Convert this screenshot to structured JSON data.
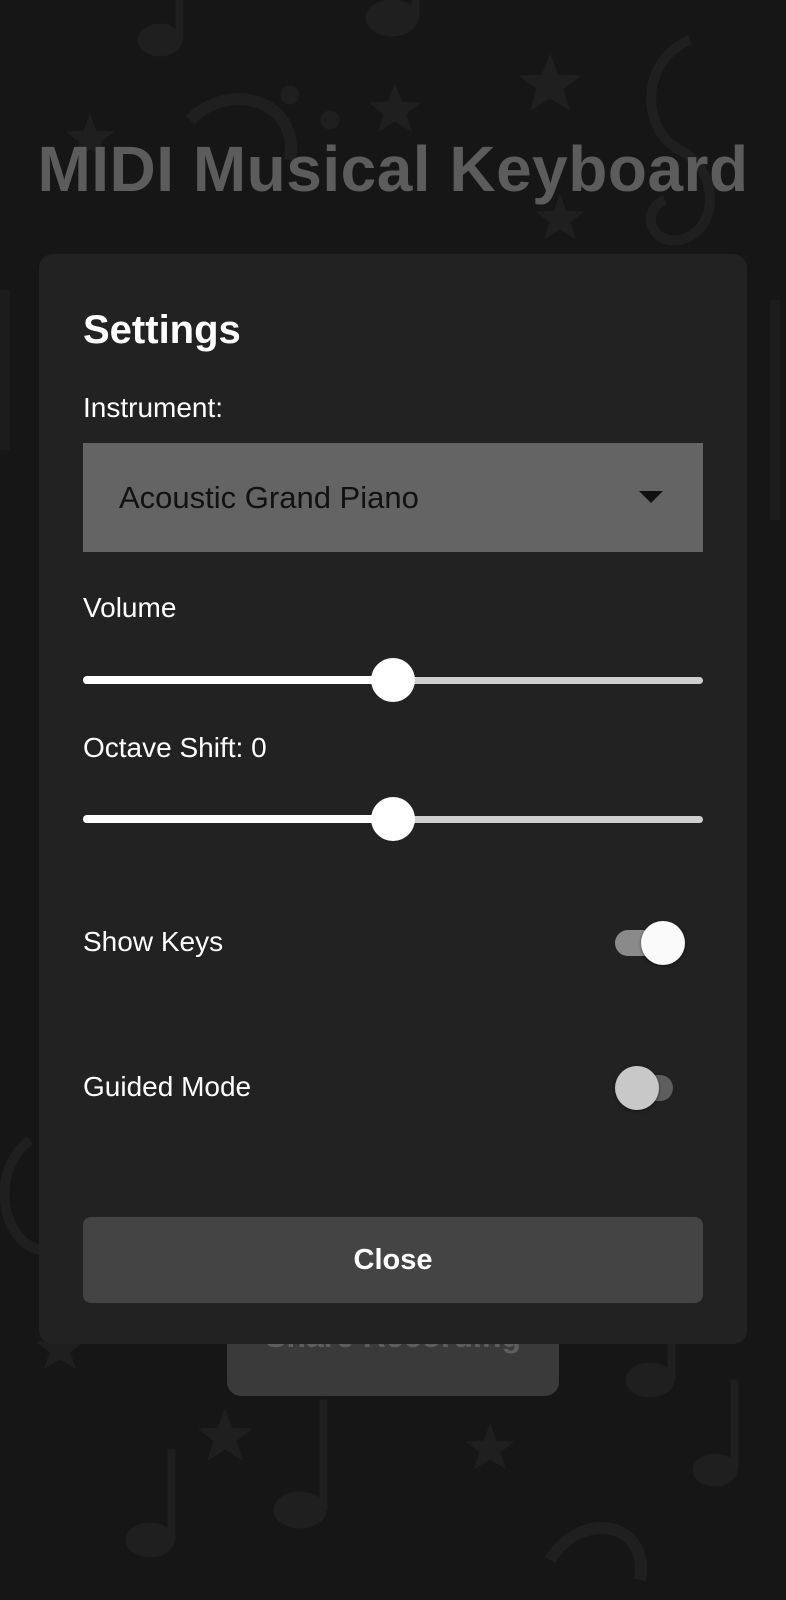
{
  "app": {
    "title": "MIDI Musical Keyboard",
    "background_button_label": "Share Recording"
  },
  "settings_dialog": {
    "title": "Settings",
    "instrument": {
      "label": "Instrument:",
      "selected": "Acoustic Grand Piano"
    },
    "volume": {
      "label": "Volume",
      "value_fraction": 0.5
    },
    "octave_shift": {
      "label": "Octave Shift: 0",
      "value_fraction": 0.5
    },
    "show_keys": {
      "label": "Show Keys",
      "enabled": true
    },
    "guided_mode": {
      "label": "Guided Mode",
      "enabled": false
    },
    "close_label": "Close"
  },
  "colors": {
    "background": "#161616",
    "dialog": "#222222",
    "select_field": "#646464",
    "close_button": "#444444",
    "title_text": "#5c5c5c"
  },
  "icons": {
    "select_caret": "caret-down-icon",
    "background_pattern": "music-note-star-pattern"
  }
}
